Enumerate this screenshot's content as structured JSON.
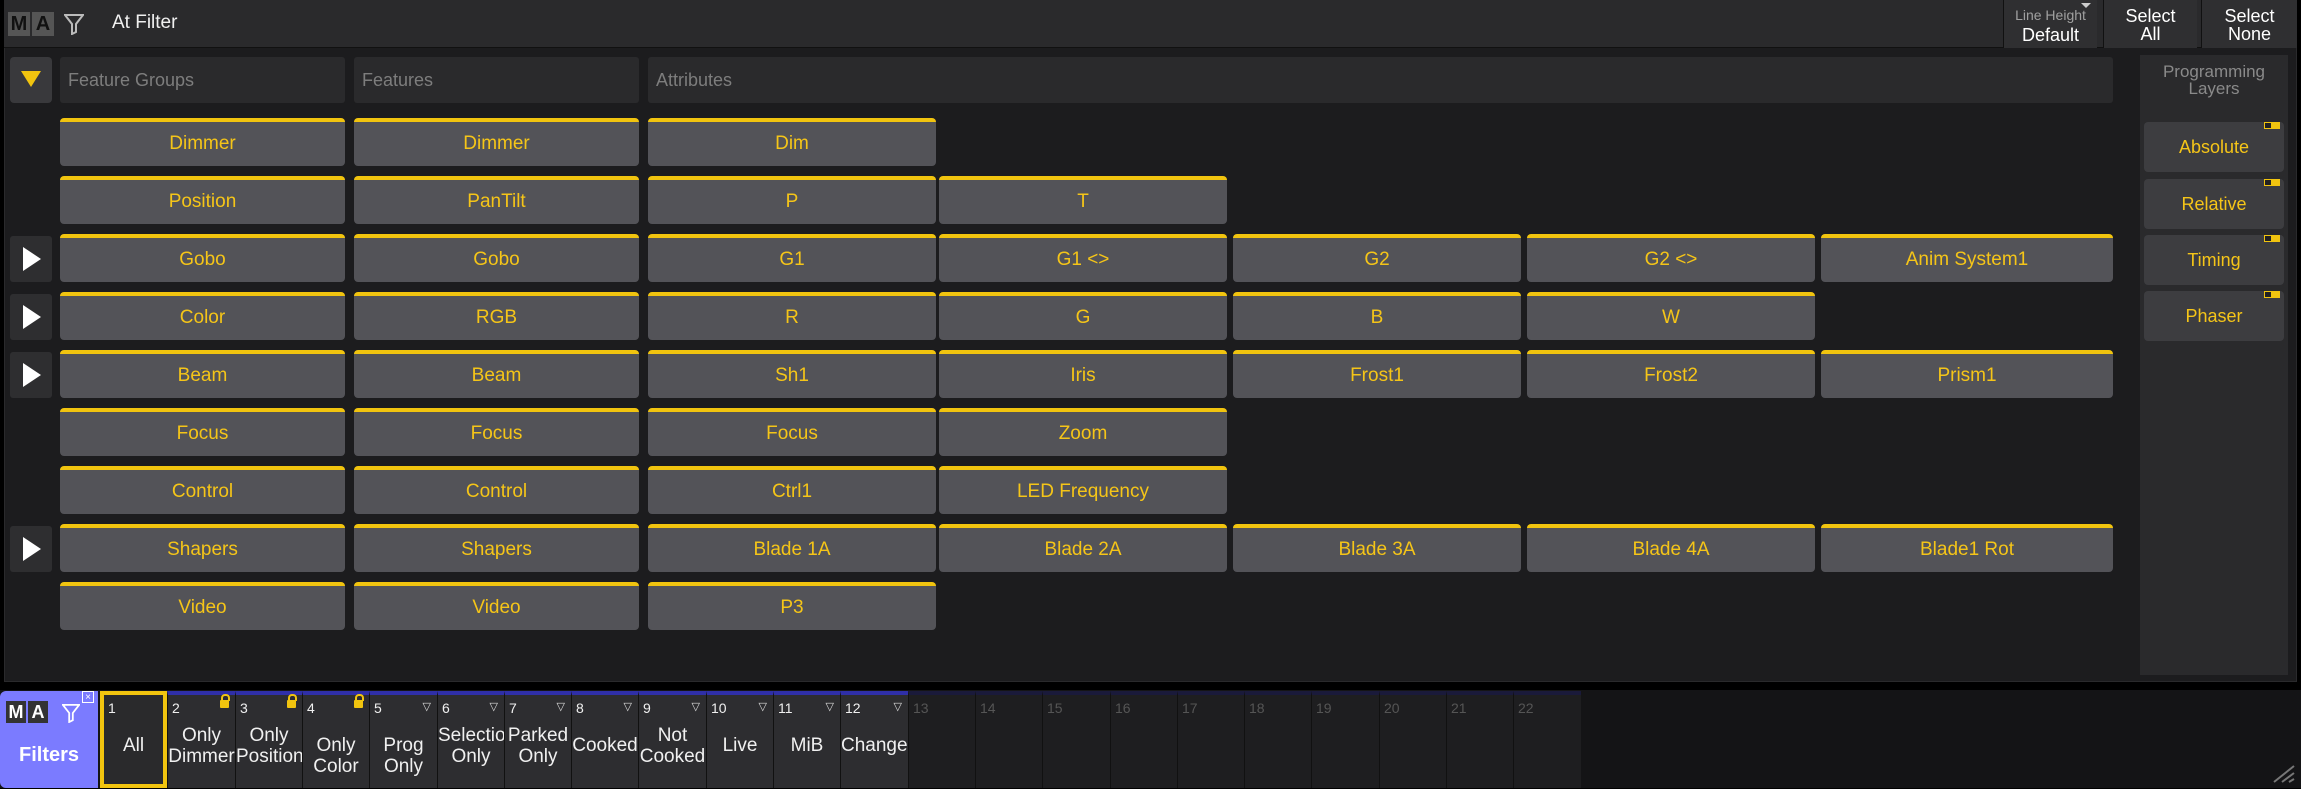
{
  "window": {
    "title": "At Filter",
    "line_height_label": "Line Height",
    "line_height_value": "Default",
    "select_all": [
      "Select",
      "All"
    ],
    "select_none": [
      "Select",
      "None"
    ]
  },
  "headers": {
    "feature_groups": "Feature Groups",
    "features": "Features",
    "attributes": "Attributes"
  },
  "rows": [
    {
      "group": "Dimmer",
      "feature": "Dimmer",
      "attributes": [
        "Dim"
      ],
      "expandable": false
    },
    {
      "group": "Position",
      "feature": "PanTilt",
      "attributes": [
        "P",
        "T"
      ],
      "expandable": false
    },
    {
      "group": "Gobo",
      "feature": "Gobo",
      "attributes": [
        "G1",
        "G1 <>",
        "G2",
        "G2 <>",
        "Anim System1"
      ],
      "expandable": true
    },
    {
      "group": "Color",
      "feature": "RGB",
      "attributes": [
        "R",
        "G",
        "B",
        "W"
      ],
      "expandable": true
    },
    {
      "group": "Beam",
      "feature": "Beam",
      "attributes": [
        "Sh1",
        "Iris",
        "Frost1",
        "Frost2",
        "Prism1"
      ],
      "expandable": true
    },
    {
      "group": "Focus",
      "feature": "Focus",
      "attributes": [
        "Focus",
        "Zoom"
      ],
      "expandable": false
    },
    {
      "group": "Control",
      "feature": "Control",
      "attributes": [
        "Ctrl1",
        "LED Frequency"
      ],
      "expandable": false
    },
    {
      "group": "Shapers",
      "feature": "Shapers",
      "attributes": [
        "Blade 1A",
        "Blade 2A",
        "Blade 3A",
        "Blade 4A",
        "Blade1 Rot"
      ],
      "expandable": true
    },
    {
      "group": "Video",
      "feature": "Video",
      "attributes": [
        "P3"
      ],
      "expandable": false
    }
  ],
  "layers": {
    "title": [
      "Programming",
      "Layers"
    ],
    "items": [
      "Absolute",
      "Relative",
      "Timing",
      "Phaser"
    ]
  },
  "filter_bar": {
    "label": "Filters",
    "items": [
      {
        "num": "1",
        "label": [
          "All"
        ],
        "icon": "",
        "selected": true
      },
      {
        "num": "2",
        "label": [
          "Only",
          "Dimmer"
        ],
        "icon": "lock-icon"
      },
      {
        "num": "3",
        "label": [
          "Only",
          "Position"
        ],
        "icon": "lock-icon"
      },
      {
        "num": "4",
        "label": [
          "Only Color"
        ],
        "icon": "lock-icon"
      },
      {
        "num": "5",
        "label": [
          "Prog Only"
        ],
        "icon": "filter-icon"
      },
      {
        "num": "6",
        "label": [
          "Selection",
          "Only"
        ],
        "icon": "filter-icon"
      },
      {
        "num": "7",
        "label": [
          "Parked",
          "Only"
        ],
        "icon": "filter-icon"
      },
      {
        "num": "8",
        "label": [
          "Cooked"
        ],
        "icon": "filter-icon"
      },
      {
        "num": "9",
        "label": [
          "Not",
          "Cooked"
        ],
        "icon": "filter-icon"
      },
      {
        "num": "10",
        "label": [
          "Live"
        ],
        "icon": "filter-icon"
      },
      {
        "num": "11",
        "label": [
          "MiB"
        ],
        "icon": "filter-icon"
      },
      {
        "num": "12",
        "label": [
          "Changed"
        ],
        "icon": "filter-icon"
      },
      {
        "num": "13",
        "label": [],
        "icon": ""
      },
      {
        "num": "14",
        "label": [],
        "icon": ""
      },
      {
        "num": "15",
        "label": [],
        "icon": ""
      },
      {
        "num": "16",
        "label": [],
        "icon": ""
      },
      {
        "num": "17",
        "label": [],
        "icon": ""
      },
      {
        "num": "18",
        "label": [],
        "icon": ""
      },
      {
        "num": "19",
        "label": [],
        "icon": ""
      },
      {
        "num": "20",
        "label": [],
        "icon": ""
      },
      {
        "num": "21",
        "label": [],
        "icon": ""
      },
      {
        "num": "22",
        "label": [],
        "icon": ""
      }
    ]
  },
  "colors": {
    "accent": "#f1c40f",
    "text_accent": "#f5c518",
    "filters_bg": "#7b7bff",
    "button_bg": "#535358"
  }
}
